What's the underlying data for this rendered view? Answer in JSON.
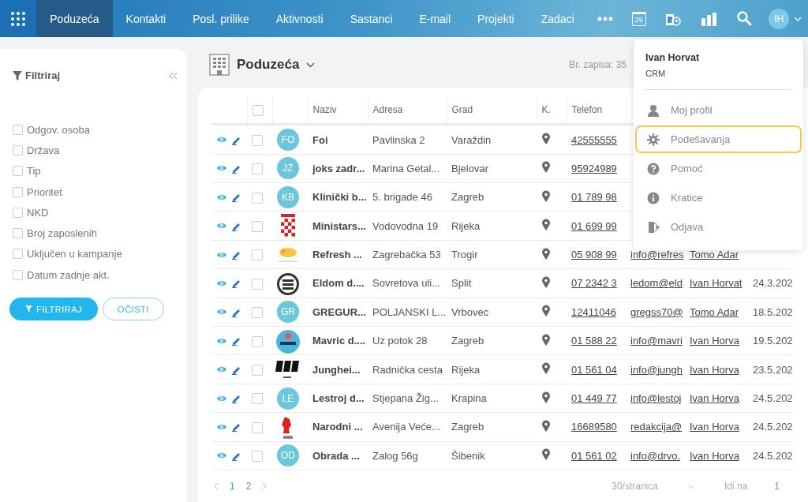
{
  "nav": {
    "tabs": [
      {
        "label": "Poduzeća",
        "selected": true
      },
      {
        "label": "Kontakti",
        "selected": false
      },
      {
        "label": "Posl. prilike",
        "selected": false
      },
      {
        "label": "Aktivnosti",
        "selected": false
      },
      {
        "label": "Sastanci",
        "selected": false
      },
      {
        "label": "E-mail",
        "selected": false
      },
      {
        "label": "Projekti",
        "selected": false
      },
      {
        "label": "Zadaci",
        "selected": false
      }
    ],
    "calendar_day": "29",
    "avatar": "IH"
  },
  "sidebar": {
    "title": "Filtriraj",
    "filters": [
      {
        "label": "Odgov. osoba",
        "checked": false
      },
      {
        "label": "Država",
        "checked": false
      },
      {
        "label": "Tip",
        "checked": false
      },
      {
        "label": "Prioritet",
        "checked": false
      },
      {
        "label": "NKD",
        "checked": false
      },
      {
        "label": "Broj zaposlenih",
        "checked": false
      },
      {
        "label": "Uključen u kampanje",
        "checked": false
      },
      {
        "label": "Datum zadnje akt.",
        "checked": false
      }
    ],
    "buttons": [
      {
        "label": "FILTRIRAJ",
        "kind": "primary"
      },
      {
        "label": "OČISTI",
        "kind": "outline"
      }
    ]
  },
  "main": {
    "title": "Poduzeća",
    "record_count": "Br. zapisa: 35"
  },
  "table": {
    "select_all_checked": false,
    "columns": [
      "Naziv",
      "Adresa",
      "Grad",
      "K.",
      "Telefon"
    ],
    "rows": [
      {
        "avatar": {
          "kind": "initials",
          "text": "FO"
        },
        "checked": false,
        "naziv": "Foi",
        "adresa": "Pavlinska 2",
        "grad": "Varaždin",
        "telefon": "42555555"
      },
      {
        "avatar": {
          "kind": "initials",
          "text": "JZ"
        },
        "checked": false,
        "naziv": "joks zadr...",
        "adresa": "Marina Getal...",
        "grad": "Bjelovar",
        "telefon": "95924989"
      },
      {
        "avatar": {
          "kind": "initials",
          "text": "KB"
        },
        "checked": false,
        "naziv": "Klinički b...",
        "adresa": "5. brigade 46",
        "grad": "Zagreb",
        "telefon": "01 789 98"
      },
      {
        "avatar": {
          "kind": "logo"
        },
        "checked": false,
        "naziv": "Ministars...",
        "adresa": "Vodovodna 19",
        "grad": "Rijeka",
        "telefon": "01 699 99"
      },
      {
        "avatar": {
          "kind": "logo"
        },
        "checked": false,
        "naziv": "Refresh ...",
        "adresa": "Zagrebačka 53",
        "grad": "Trogir",
        "telefon": "05 908 99",
        "email": "info@refres",
        "column_8": "Tomo Adar"
      },
      {
        "avatar": {
          "kind": "logo"
        },
        "checked": false,
        "naziv": "Eldom d....",
        "adresa": "Sovretova uli...",
        "grad": "Split",
        "telefon": "07 2342 3",
        "email": "ledom@eld",
        "column_8": "Ivan Horvat",
        "column_9": "24.3.202"
      },
      {
        "avatar": {
          "kind": "initials",
          "text": "GR"
        },
        "checked": false,
        "naziv": "GREGUR...",
        "adresa": "POLJANSKI L...",
        "grad": "Vrbovec",
        "telefon": "12411046",
        "email": "gregss70@",
        "column_8": "Tomo Adar",
        "column_9": "18.5.202"
      },
      {
        "avatar": {
          "kind": "logo"
        },
        "checked": false,
        "naziv": "Mavric d....",
        "adresa": "Uz potok 28",
        "grad": "Zagreb",
        "telefon": "01 588 22",
        "email": "info@mavri",
        "column_8": "Ivan Horva",
        "column_9": "19.5.202"
      },
      {
        "avatar": {
          "kind": "logo"
        },
        "checked": false,
        "naziv": "Junghei...",
        "adresa": "Radnička cesta",
        "grad": "Rijeka",
        "telefon": "01 561 04",
        "email": "info@jungh",
        "column_8": "Ivan Horva",
        "column_9": "23.5.202"
      },
      {
        "avatar": {
          "kind": "initials",
          "text": "LE"
        },
        "checked": false,
        "naziv": "Lestroj d...",
        "adresa": "Stjepana Žig...",
        "grad": "Krapina",
        "telefon": "01 449 77",
        "email": "info@lestoj",
        "column_8": "Ivan Horva",
        "column_9": "24.5.202"
      },
      {
        "avatar": {
          "kind": "logo"
        },
        "checked": false,
        "naziv": "Narodni ...",
        "adresa": "Avenija Veće...",
        "grad": "Zagreb",
        "telefon": "16689580",
        "email": "redakcija@",
        "column_8": "Ivan Horva",
        "column_9": "24.5.202"
      },
      {
        "avatar": {
          "kind": "initials",
          "text": "OD"
        },
        "checked": false,
        "naziv": "Obrada ...",
        "adresa": "Zalog 56g",
        "grad": "Šibenik",
        "telefon": "01 561 02",
        "email": "info@drvo.",
        "column_8": "Ivan Horva",
        "column_9": "24.5.202"
      }
    ]
  },
  "pagination": {
    "pages": [
      {
        "label": "1",
        "selected": true
      },
      {
        "label": "2",
        "selected": false
      }
    ],
    "page_size": "30/stranica",
    "goto_label": "Idi na",
    "goto_value": "1"
  },
  "user_menu": {
    "name": "Ivan Horvat",
    "role": "CRM",
    "items": [
      {
        "label": "Moj profil",
        "kind": "person",
        "selected": false
      },
      {
        "label": "Podešavanja",
        "kind": "gear",
        "selected": true
      },
      {
        "label": "Pomoć",
        "kind": "help",
        "selected": false
      },
      {
        "label": "Kratice",
        "kind": "info",
        "selected": false
      },
      {
        "label": "Odjava",
        "kind": "exit",
        "selected": false
      }
    ]
  }
}
